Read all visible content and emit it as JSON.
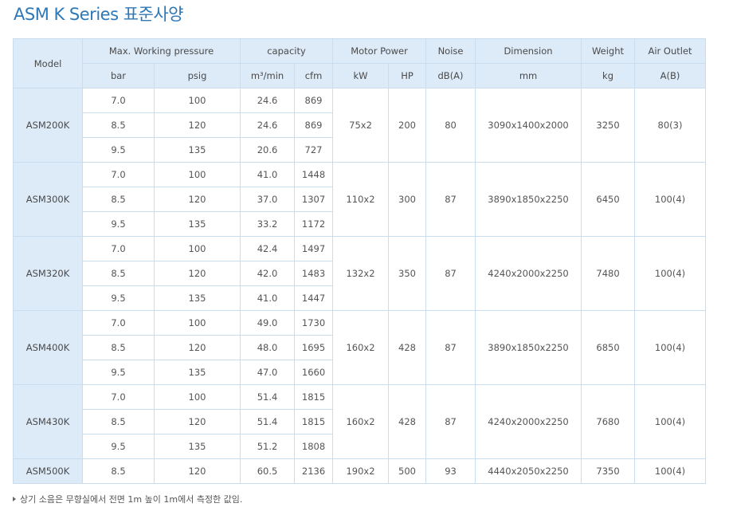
{
  "title": "ASM K Series 표준사양",
  "header": {
    "model": "Model",
    "pressure": "Max. Working pressure",
    "capacity": "capacity",
    "motor_power": "Motor Power",
    "noise": "Noise",
    "dimension": "Dimension",
    "weight": "Weight",
    "air_outlet": "Air Outlet",
    "units": [
      "bar",
      "psig",
      "m³/min",
      "cfm",
      "kW",
      "HP",
      "dB(A)",
      "mm",
      "kg",
      "A(B)"
    ]
  },
  "models": [
    {
      "name": "ASM200K",
      "kw": "75x2",
      "hp": "200",
      "noise": "80",
      "dimension": "3090x1400x2000",
      "weight": "3250",
      "outlet": "80(3)",
      "rows": [
        {
          "bar": "7.0",
          "psig": "100",
          "m3": "24.6",
          "cfm": "869"
        },
        {
          "bar": "8.5",
          "psig": "120",
          "m3": "24.6",
          "cfm": "869"
        },
        {
          "bar": "9.5",
          "psig": "135",
          "m3": "20.6",
          "cfm": "727"
        }
      ]
    },
    {
      "name": "ASM300K",
      "kw": "110x2",
      "hp": "300",
      "noise": "87",
      "dimension": "3890x1850x2250",
      "weight": "6450",
      "outlet": "100(4)",
      "rows": [
        {
          "bar": "7.0",
          "psig": "100",
          "m3": "41.0",
          "cfm": "1448"
        },
        {
          "bar": "8.5",
          "psig": "120",
          "m3": "37.0",
          "cfm": "1307"
        },
        {
          "bar": "9.5",
          "psig": "135",
          "m3": "33.2",
          "cfm": "1172"
        }
      ]
    },
    {
      "name": "ASM320K",
      "kw": "132x2",
      "hp": "350",
      "noise": "87",
      "dimension": "4240x2000x2250",
      "weight": "7480",
      "outlet": "100(4)",
      "rows": [
        {
          "bar": "7.0",
          "psig": "100",
          "m3": "42.4",
          "cfm": "1497"
        },
        {
          "bar": "8.5",
          "psig": "120",
          "m3": "42.0",
          "cfm": "1483"
        },
        {
          "bar": "9.5",
          "psig": "135",
          "m3": "41.0",
          "cfm": "1447"
        }
      ]
    },
    {
      "name": "ASM400K",
      "kw": "160x2",
      "hp": "428",
      "noise": "87",
      "dimension": "3890x1850x2250",
      "weight": "6850",
      "outlet": "100(4)",
      "rows": [
        {
          "bar": "7.0",
          "psig": "100",
          "m3": "49.0",
          "cfm": "1730"
        },
        {
          "bar": "8.5",
          "psig": "120",
          "m3": "48.0",
          "cfm": "1695"
        },
        {
          "bar": "9.5",
          "psig": "135",
          "m3": "47.0",
          "cfm": "1660"
        }
      ]
    },
    {
      "name": "ASM430K",
      "kw": "160x2",
      "hp": "428",
      "noise": "87",
      "dimension": "4240x2000x2250",
      "weight": "7680",
      "outlet": "100(4)",
      "rows": [
        {
          "bar": "7.0",
          "psig": "100",
          "m3": "51.4",
          "cfm": "1815"
        },
        {
          "bar": "8.5",
          "psig": "120",
          "m3": "51.4",
          "cfm": "1815"
        },
        {
          "bar": "9.5",
          "psig": "135",
          "m3": "51.2",
          "cfm": "1808"
        }
      ]
    },
    {
      "name": "ASM500K",
      "kw": "190x2",
      "hp": "500",
      "noise": "93",
      "dimension": "4440x2050x2250",
      "weight": "7350",
      "outlet": "100(4)",
      "rows": [
        {
          "bar": "8.5",
          "psig": "120",
          "m3": "60.5",
          "cfm": "2136"
        }
      ]
    }
  ],
  "note": "상기 소음은 무향실에서 전면 1m 높이 1m에서 측정한 값임."
}
